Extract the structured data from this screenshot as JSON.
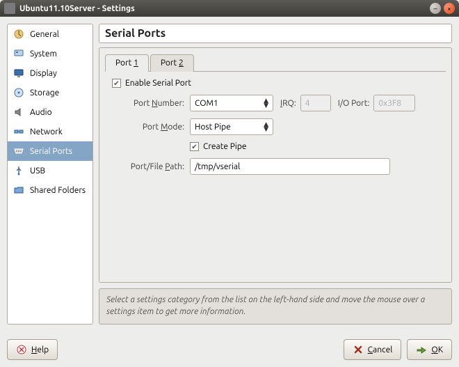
{
  "window": {
    "title": "Ubuntu11.10Server - Settings"
  },
  "sidebar": {
    "items": [
      {
        "label": "General"
      },
      {
        "label": "System"
      },
      {
        "label": "Display"
      },
      {
        "label": "Storage"
      },
      {
        "label": "Audio"
      },
      {
        "label": "Network"
      },
      {
        "label": "Serial Ports"
      },
      {
        "label": "USB"
      },
      {
        "label": "Shared Folders"
      }
    ],
    "selected_index": 6
  },
  "heading": "Serial Ports",
  "tabs": {
    "items": [
      {
        "prefix": "Port ",
        "accel": "1"
      },
      {
        "prefix": "Port ",
        "accel": "2"
      }
    ],
    "active_index": 0
  },
  "form": {
    "enable_prefix": "",
    "enable_accel": "E",
    "enable_suffix": "nable Serial Port",
    "enable_checked": true,
    "port_number_label_pre": "Port ",
    "port_number_label_accel": "N",
    "port_number_label_post": "umber:",
    "port_number_value": "COM1",
    "irq_label_accel": "I",
    "irq_label_post": "RQ:",
    "irq_value": "4",
    "io_label": "I/O Port:",
    "io_value": "0x3F8",
    "port_mode_label_pre": "Port ",
    "port_mode_label_accel": "M",
    "port_mode_label_post": "ode:",
    "port_mode_value": "Host Pipe",
    "create_pipe_accel": "C",
    "create_pipe_post": "reate Pipe",
    "create_pipe_checked": true,
    "path_label_pre": "Port/File ",
    "path_label_accel": "P",
    "path_label_post": "ath:",
    "path_value": "/tmp/vserial"
  },
  "hint": "Select a settings category from the list on the left-hand side and move the mouse over a settings item to get more information.",
  "buttons": {
    "help_accel": "H",
    "help_post": "elp",
    "cancel_accel": "C",
    "cancel_post": "ancel",
    "ok_accel": "O",
    "ok_post": "K"
  }
}
